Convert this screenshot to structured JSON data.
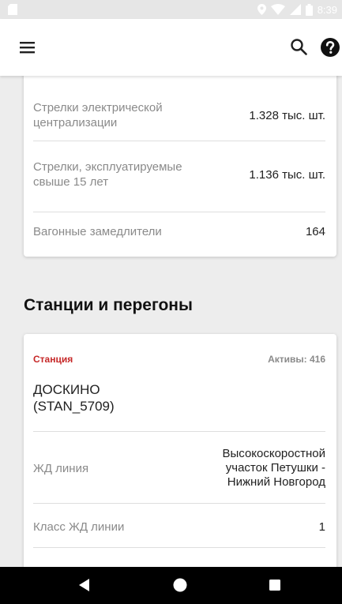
{
  "status_bar": {
    "time": "8:39"
  },
  "icons": {
    "menu": "hamburger-menu-icon",
    "search": "magnifier-search-icon",
    "help": "question-circle-help-icon"
  },
  "summary_card": {
    "rows": [
      {
        "label": "Стрелки электрической централизации",
        "value": "1.328 тыс. шт."
      },
      {
        "label": "Стрелки, эксплуатируемые свыше 15 лет",
        "value": "1.136 тыс. шт."
      },
      {
        "label": "Вагонные замедлители",
        "value": "164"
      }
    ]
  },
  "section": {
    "title": "Станции и перегоны"
  },
  "station_card": {
    "type": "Станция",
    "assets": "Активы: 416",
    "name_line1": "ДОСКИНО",
    "name_line2": "(STAN_5709)",
    "rows": [
      {
        "label": "ЖД линия",
        "value": "Высокоскоростной участок Петушки - Нижний Новгород"
      },
      {
        "label": "Класс ЖД линии",
        "value": "1"
      }
    ]
  },
  "colors": {
    "accent": "#c62828",
    "background": "#ededed",
    "card": "#ffffff",
    "nav_bar": "#000000"
  }
}
